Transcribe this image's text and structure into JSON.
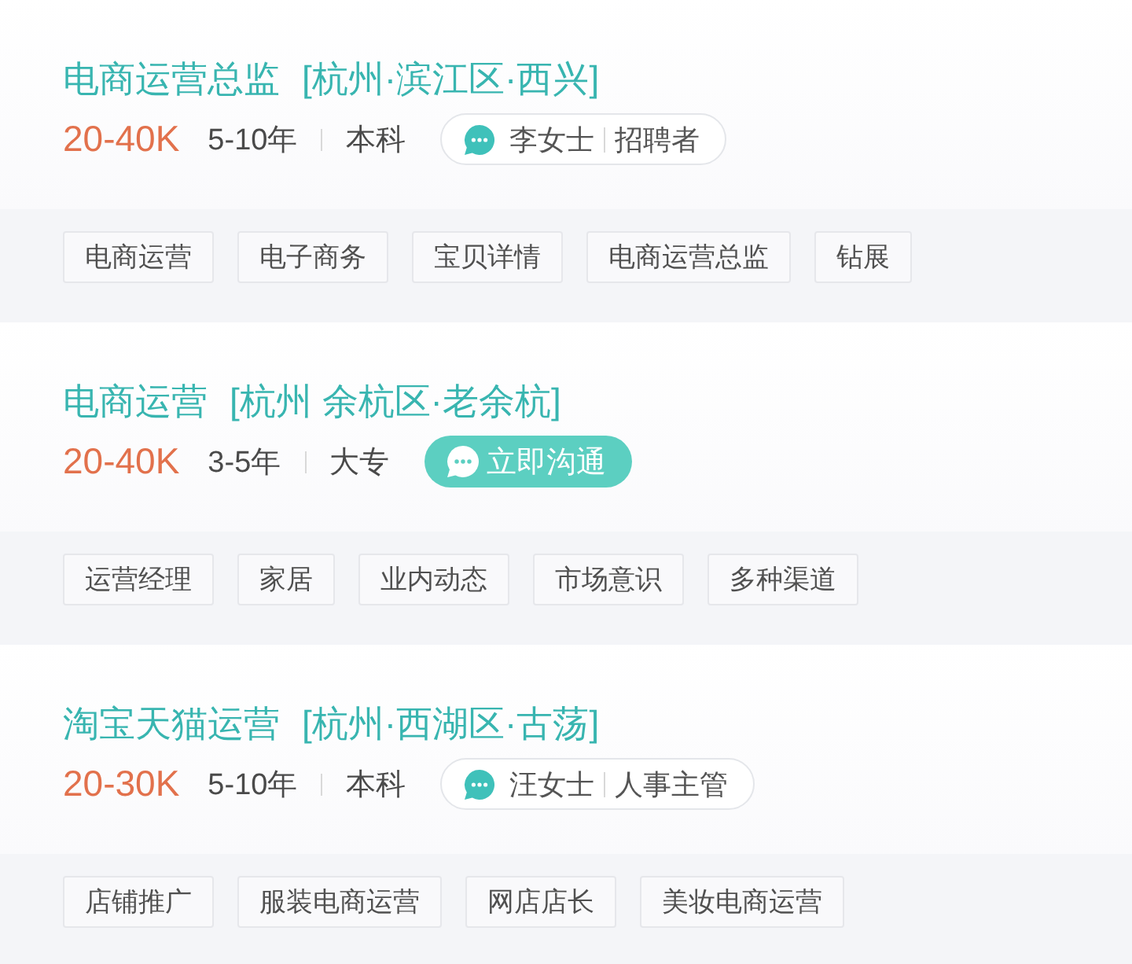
{
  "jobs": [
    {
      "title": "电商运营总监",
      "location": "[杭州·滨江区·西兴]",
      "salary": "20-40K",
      "experience": "5-10年",
      "education": "本科",
      "contact": {
        "kind": "recruiter",
        "name": "李女士",
        "role": "招聘者"
      },
      "tags": [
        "电商运营",
        "电子商务",
        "宝贝详情",
        "电商运营总监",
        "钻展"
      ]
    },
    {
      "title": "电商运营",
      "location": "[杭州 余杭区·老余杭]",
      "salary": "20-40K",
      "experience": "3-5年",
      "education": "大专",
      "contact": {
        "kind": "button",
        "label": "立即沟通"
      },
      "tags": [
        "运营经理",
        "家居",
        "业内动态",
        "市场意识",
        "多种渠道"
      ]
    },
    {
      "title": "淘宝天猫运营",
      "location": "[杭州·西湖区·古荡]",
      "salary": "20-30K",
      "experience": "5-10年",
      "education": "本科",
      "contact": {
        "kind": "recruiter",
        "name": "汪女士",
        "role": "人事主管"
      },
      "tags": [
        "店铺推广",
        "服装电商运营",
        "网店店长",
        "美妆电商运营"
      ]
    }
  ]
}
